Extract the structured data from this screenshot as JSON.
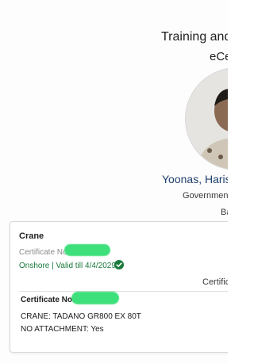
{
  "header": {
    "title": "Training and",
    "subtitle": "eCe"
  },
  "profile": {
    "name": "Yoonas, Haris",
    "organization": "Government",
    "location": "Ba"
  },
  "certificate_card": {
    "title": "Crane",
    "certificate_no_label_muted": "Certificate No",
    "validity": "Onshore | Valid till 4/4/2029",
    "column_label": "Certifica",
    "certificate_no_label": "Certificate No:",
    "crane": "CRANE: TADANO GR800 EX 80T",
    "attachment": "NO ATTACHMENT: Yes"
  },
  "colors": {
    "accent_name": "#1f3f6e",
    "valid_green": "#1a7a3c",
    "redaction": "#3ee07b"
  },
  "icons": {
    "valid": "check-circle-icon",
    "avatar": "profile-photo"
  }
}
